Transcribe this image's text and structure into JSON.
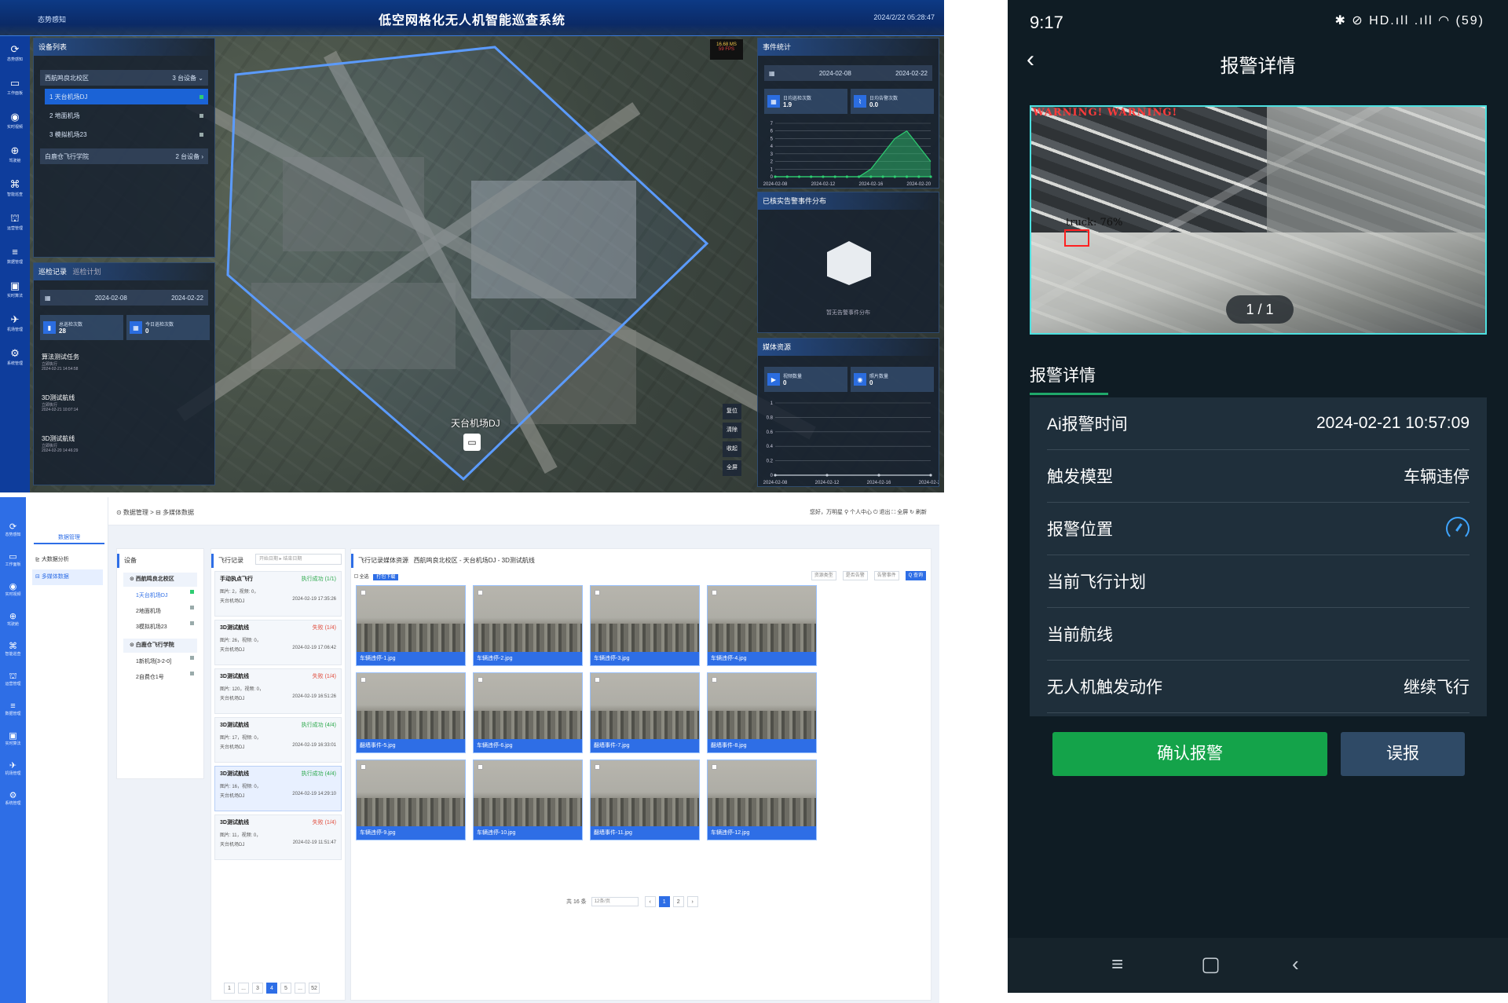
{
  "dashboard": {
    "title": "低空网格化无人机智能巡查系统",
    "subtitle": "态势感知",
    "time": "2024/2/22 05:28:47",
    "nav": [
      {
        "icon": "⟳",
        "label": "态势感知"
      },
      {
        "icon": "▭",
        "label": "工作面板"
      },
      {
        "icon": "◉",
        "label": "实时视频"
      },
      {
        "icon": "⊕",
        "label": "驾驶舱"
      },
      {
        "icon": "⌘",
        "label": "智能巡查"
      },
      {
        "icon": "⛫",
        "label": "运营管理"
      },
      {
        "icon": "≡",
        "label": "数据管理"
      },
      {
        "icon": "▣",
        "label": "实时算法"
      },
      {
        "icon": "✈",
        "label": "机场管理"
      },
      {
        "icon": "⚙",
        "label": "系统管理"
      }
    ],
    "device_list": {
      "title": "设备列表",
      "groups": [
        {
          "name": "西航鸣良北校区",
          "count": "3 台设备 ⌄",
          "items": [
            "1 天台机场DJ",
            "2 地面机场",
            "3 模拟机场23"
          ]
        },
        {
          "name": "白鹿仓飞行学院",
          "count": "2 台设备 ›",
          "items": []
        }
      ]
    },
    "patrol": {
      "tabs": [
        "巡检记录",
        "巡检计划"
      ],
      "date_from": "2024-02-08",
      "date_to": "2024-02-22",
      "stats": [
        {
          "label": "总巡检次数",
          "value": "28"
        },
        {
          "label": "今日巡检次数",
          "value": "0"
        }
      ],
      "tasks": [
        {
          "name": "算法测试任务",
          "mode": "立即执行",
          "time": "2024-02-21 14:54:58"
        },
        {
          "name": "3D测试航线",
          "mode": "立即执行",
          "time": "2024-02-21 10:07:14"
        },
        {
          "name": "3D测试航线",
          "mode": "立即执行",
          "time": "2024-02-20 14:46:29"
        }
      ]
    },
    "event_stats": {
      "title": "事件统计",
      "date_from": "2024-02-08",
      "date_to": "2024-02-22",
      "stats": [
        {
          "label": "日均巡检次数",
          "value": "1.9"
        },
        {
          "label": "日均告警次数",
          "value": "0.0"
        }
      ],
      "chart_data": {
        "type": "line",
        "title": "",
        "xlabel": "",
        "ylabel": "",
        "x": [
          "2024-02-08",
          "2024-02-09",
          "2024-02-10",
          "2024-02-11",
          "2024-02-12",
          "2024-02-13",
          "2024-02-14",
          "2024-02-15",
          "2024-02-16",
          "2024-02-17",
          "2024-02-18",
          "2024-02-19",
          "2024-02-20",
          "2024-02-21"
        ],
        "series": [
          {
            "values": [
              0,
              0,
              0,
              0,
              0,
              0,
              0,
              0,
              0,
              0,
              0,
              0,
              0,
              0
            ],
            "color": "#2ecc71"
          },
          {
            "values": [
              0,
              0,
              0,
              0,
              0,
              0,
              0,
              0,
              1,
              3,
              5,
              6,
              4,
              2
            ],
            "color": "#2ecc71",
            "fill": true
          }
        ],
        "xticks": [
          "2024-02-08",
          "2024-02-12",
          "2024-02-16",
          "2024-02-20"
        ],
        "yticks": [
          0,
          1,
          2,
          3,
          4,
          5,
          6,
          7
        ],
        "ylim": [
          0,
          7
        ]
      }
    },
    "dist": {
      "title": "已核实告警事件分布",
      "empty": "暂无告警事件分布"
    },
    "media": {
      "title": "媒体资源",
      "stats": [
        {
          "label": "视频数量",
          "value": "0"
        },
        {
          "label": "照片数量",
          "value": "0"
        }
      ],
      "chart_data": {
        "type": "line",
        "title": "",
        "xlabel": "",
        "ylabel": "",
        "x": [
          "2024-02-08",
          "2024-02-12",
          "2024-02-16",
          "2024-02-20"
        ],
        "series": [
          {
            "values": [
              0,
              0,
              0,
              0
            ],
            "color": "#c8d0da"
          }
        ],
        "yticks": [
          0,
          0.2,
          0.4,
          0.6,
          0.8,
          1
        ],
        "ylim": [
          0,
          1
        ]
      }
    },
    "map": {
      "fps_ms": "16.68 MS",
      "fps": "59 FPS",
      "drone_label": "天台机场DJ",
      "buttons": [
        "复位",
        "清除",
        "收起",
        "全屏"
      ]
    }
  },
  "data_mgmt": {
    "nav": [
      {
        "icon": "⟳",
        "label": "态势感知"
      },
      {
        "icon": "▭",
        "label": "工作面板"
      },
      {
        "icon": "◉",
        "label": "实时视频"
      },
      {
        "icon": "⊕",
        "label": "驾驶舱"
      },
      {
        "icon": "⌘",
        "label": "智能巡查"
      },
      {
        "icon": "⛫",
        "label": "运营管理"
      },
      {
        "icon": "≡",
        "label": "数据管理"
      },
      {
        "icon": "▣",
        "label": "实时算法"
      },
      {
        "icon": "✈",
        "label": "机场管理"
      },
      {
        "icon": "⚙",
        "label": "系统管理"
      }
    ],
    "sub_tab": "数据管理",
    "sub_menu": [
      "大数据分析",
      "多媒体数据"
    ],
    "breadcrumb": "⊙ 数据管理 > ⊟ 多媒体数据",
    "top_right": "您好，万明星  ⚲ 个人中心  ⏻ 退出  ⛶ 全屏  ↻ 刷新",
    "devices": {
      "title": "设备",
      "groups": [
        {
          "name": "⊙ 西航鸣良北校区",
          "items": [
            "1天台机场DJ",
            "2地面机场",
            "3模拟机场23"
          ]
        },
        {
          "name": "⊙ 白鹿仓飞行学院",
          "items": [
            "1新机场[3-2-0]",
            "2自费仓1号"
          ]
        }
      ]
    },
    "flights": {
      "title": "飞行记录",
      "start_placeholder": "开始日期",
      "end_placeholder": "结束日期",
      "records": [
        {
          "name": "手动执点飞行",
          "status": "执行成功 (1/1)",
          "ok": true,
          "photos": "图片: 2，视频: 0，",
          "device": "天台机场DJ",
          "time": "2024-02-19 17:35:26"
        },
        {
          "name": "3D测试航线",
          "status": "失败 (1/4)",
          "ok": false,
          "photos": "图片: 26，视频: 0，",
          "device": "天台机场DJ",
          "time": "2024-02-19 17:06:42"
        },
        {
          "name": "3D测试航线",
          "status": "失败 (1/4)",
          "ok": false,
          "photos": "图片: 120，视频: 0，",
          "device": "天台机场DJ",
          "time": "2024-02-19 16:51:26"
        },
        {
          "name": "3D测试航线",
          "status": "执行成功 (4/4)",
          "ok": true,
          "photos": "图片: 17，视频: 0，",
          "device": "天台机场DJ",
          "time": "2024-02-19 16:33:01"
        },
        {
          "name": "3D测试航线",
          "status": "执行成功 (4/4)",
          "ok": true,
          "photos": "图片: 16，视频: 0，",
          "device": "天台机场DJ",
          "time": "2024-02-19 14:29:10"
        },
        {
          "name": "3D测试航线",
          "status": "失败 (1/4)",
          "ok": false,
          "photos": "图片: 11，视频: 0，",
          "device": "天台机场DJ",
          "time": "2024-02-19 11:51:47"
        }
      ],
      "pages": [
        "1",
        "...",
        "3",
        "4",
        "5",
        "...",
        "52"
      ],
      "active_page": "4"
    },
    "media": {
      "title": "飞行记录媒体资源",
      "path": "西航鸣良北校区 - 天台机场DJ - 3D测试航线",
      "select_all": "全选",
      "batch_btn": "打包下载",
      "filters": [
        "资源类型",
        "是否告警",
        "告警事件"
      ],
      "search_btn": "Q 查询",
      "images": [
        "车辆违停-1.jpg",
        "车辆违停-2.jpg",
        "车辆违停-3.jpg",
        "车辆违停-4.jpg",
        "翻墙事件-5.jpg",
        "车辆违停-6.jpg",
        "翻墙事件-7.jpg",
        "翻墙事件-8.jpg",
        "车辆违停-9.jpg",
        "车辆违停-10.jpg",
        "翻墙事件-11.jpg",
        "车辆违停-12.jpg"
      ],
      "total": "共 16 条",
      "per_page": "12条/页",
      "pages": [
        "‹",
        "1",
        "2",
        "›"
      ],
      "active_page": "1"
    }
  },
  "phone": {
    "status_time": "9:17",
    "status_icons": "✱ ⊘ HD.ıll .ıll ◠ (59)",
    "title": "报警详情",
    "warning": "WARNING! WARNING!",
    "detection": "truck: 76%",
    "indicator": "1 / 1",
    "section": "报警详情",
    "details": [
      {
        "label": "Ai报警时间",
        "value": "2024-02-21 10:57:09"
      },
      {
        "label": "触发模型",
        "value": "车辆违停"
      },
      {
        "label": "报警位置",
        "value": ""
      },
      {
        "label": "当前飞行计划",
        "value": ""
      },
      {
        "label": "当前航线",
        "value": ""
      },
      {
        "label": "无人机触发动作",
        "value": "继续飞行"
      }
    ],
    "confirm": "确认报警",
    "false_alarm": "误报",
    "nav": [
      "≡",
      "▢",
      "‹"
    ]
  }
}
